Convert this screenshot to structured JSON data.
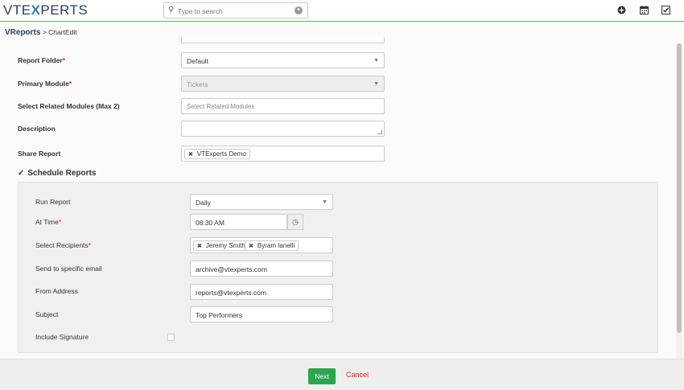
{
  "header": {
    "logo_pre": "VTE",
    "logo_x": "X",
    "logo_post": "PERTS",
    "search_placeholder": "Type to search",
    "icons": [
      "plus-circle-icon",
      "calendar-icon",
      "tasks-icon"
    ]
  },
  "breadcrumb": {
    "module": "VReports",
    "separator": ">",
    "page": "ChartEdit"
  },
  "form": {
    "report_folder": {
      "label": "Report Folder",
      "required": "*",
      "value": "Default"
    },
    "primary_module": {
      "label": "Primary Module",
      "required": "*",
      "value": "Tickets"
    },
    "related_modules": {
      "label": "Select Related Modules (Max 2)",
      "placeholder": "Select Related Modules"
    },
    "description": {
      "label": "Description",
      "value": ""
    },
    "share_report": {
      "label": "Share Report",
      "tags": [
        "VTExperts Demo"
      ]
    }
  },
  "schedule": {
    "toggle_label": "Schedule Reports",
    "run_report": {
      "label": "Run Report",
      "value": "Daily"
    },
    "at_time": {
      "label": "At Time",
      "required": "*",
      "value": "08:30 AM"
    },
    "recipients": {
      "label": "Select Recipients",
      "required": "*",
      "tags": [
        "Jeremy Smith",
        "Byram Ianelli"
      ]
    },
    "specific_email": {
      "label": "Send to specific email",
      "value": "archive@vtexperts.com"
    },
    "from_address": {
      "label": "From Address",
      "value": "reports@vtexperts.com"
    },
    "subject": {
      "label": "Subject",
      "value": "Top Performers"
    },
    "signature": {
      "label": "Include Signature",
      "checked": false
    }
  },
  "footer": {
    "next_label": "Next",
    "cancel_label": "Cancel"
  },
  "colors": {
    "accent_green": "#2ea44f",
    "required_red": "#e02020",
    "brand_blue": "#2b7bbd"
  }
}
